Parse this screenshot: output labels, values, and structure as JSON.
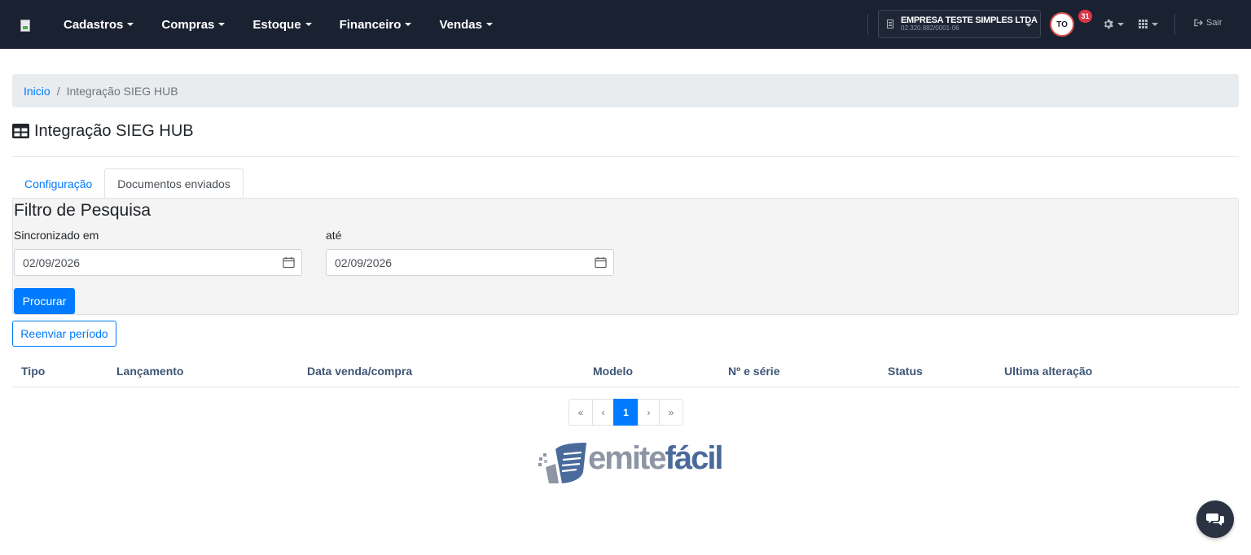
{
  "navbar": {
    "menu": [
      {
        "label": "Cadastros"
      },
      {
        "label": "Compras"
      },
      {
        "label": "Estoque"
      },
      {
        "label": "Financeiro"
      },
      {
        "label": "Vendas"
      }
    ],
    "company": {
      "name": "EMPRESA TESTE SIMPLES LTDA",
      "cnpj": "02.320.882/0001-06"
    },
    "user_initials": "TO",
    "notification_count": "31",
    "logout_label": "Sair"
  },
  "breadcrumb": {
    "home": "Inicio",
    "separator": "/",
    "current": "Integração SIEG HUB"
  },
  "page": {
    "title": "Integração SIEG HUB",
    "icon": "table-icon"
  },
  "tabs": [
    {
      "label": "Configuração",
      "active": false
    },
    {
      "label": "Documentos enviados",
      "active": true
    }
  ],
  "filter": {
    "title": "Filtro de Pesquisa",
    "from_label": "Sincronizado em",
    "from_value": "02/09/2026",
    "to_label": "até",
    "to_value": "02/09/2026",
    "search_button": "Procurar"
  },
  "resend_button": "Reenviar período",
  "table": {
    "columns": [
      "Tipo",
      "Lançamento",
      "Data venda/compra",
      "Modelo",
      "Nº e série",
      "Status",
      "Ultima alteração"
    ]
  },
  "pagination": {
    "first": "«",
    "prev": "‹",
    "current": "1",
    "next": "›",
    "last": "»"
  },
  "brand": {
    "part1": "emite",
    "part2": "fácil"
  },
  "colors": {
    "navbar": "#1a2130",
    "primary": "#007bff",
    "danger": "#dc3545",
    "table_header_text": "#3d5575"
  }
}
